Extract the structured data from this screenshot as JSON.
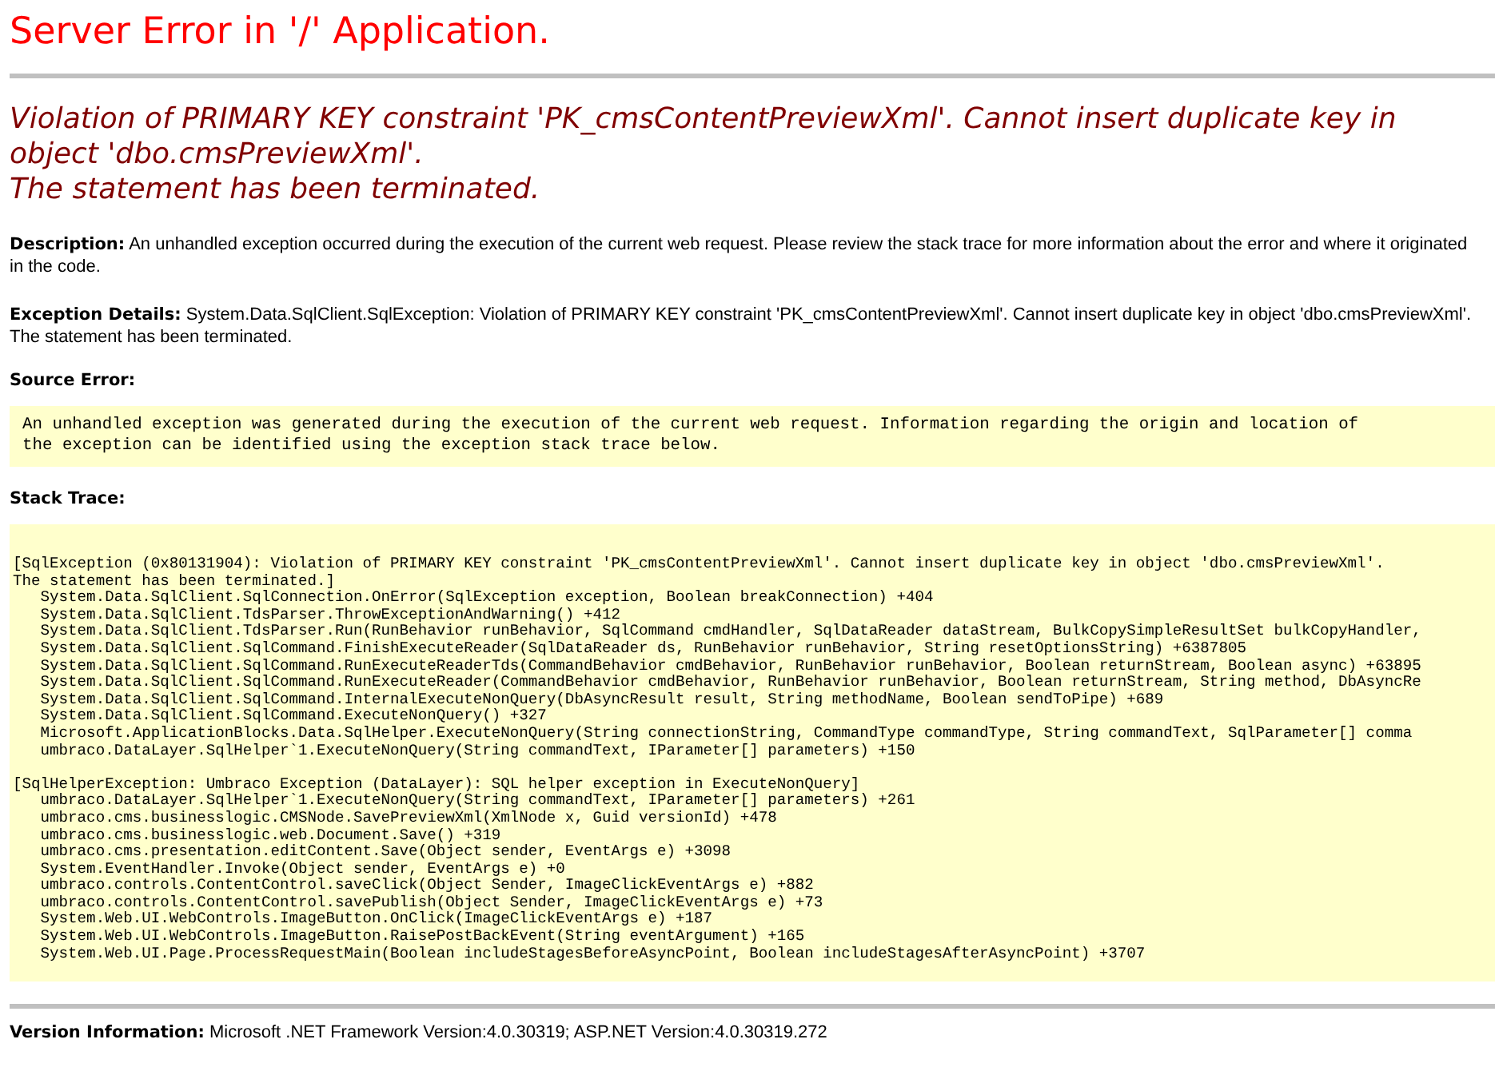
{
  "title": "Server Error in '/' Application.",
  "error_message": [
    "Violation of PRIMARY KEY constraint 'PK_cmsContentPreviewXml'. Cannot insert duplicate key in object 'dbo.cmsPreviewXml'.",
    "The statement has been terminated."
  ],
  "description": "**Description:** An unhandled exception occurred during the execution of the current web request. Please review the stack trace for more information about the error and where it originated in the code.",
  "exception_details": [
    "**Exception Details:** System.Data.SqlClient.SqlException: Violation of PRIMARY KEY constraint 'PK_cmsContentPreviewXml'. Cannot insert duplicate key in object 'dbo.cmsPreviewXml'.",
    "The statement has been terminated."
  ],
  "source_error": {
    "label": "Source Error:",
    "lines": [
      "An unhandled exception was generated during the execution of the current web request. Information regarding the origin and location of",
      "the exception can be identified using the exception stack trace below."
    ]
  },
  "stack_trace": {
    "label": "Stack Trace:",
    "blocks": [
      [
        "[SqlException (0x80131904): Violation of PRIMARY KEY constraint 'PK_cmsContentPreviewXml'. Cannot insert duplicate key in object 'dbo.cmsPreviewXml'.",
        "The statement has been terminated.]",
        "   System.Data.SqlClient.SqlConnection.OnError(SqlException exception, Boolean breakConnection) +404",
        "   System.Data.SqlClient.TdsParser.ThrowExceptionAndWarning() +412",
        "   System.Data.SqlClient.TdsParser.Run(RunBehavior runBehavior, SqlCommand cmdHandler, SqlDataReader dataStream, BulkCopySimpleResultSet bulkCopyHandler,",
        "   System.Data.SqlClient.SqlCommand.FinishExecuteReader(SqlDataReader ds, RunBehavior runBehavior, String resetOptionsString) +6387805",
        "   System.Data.SqlClient.SqlCommand.RunExecuteReaderTds(CommandBehavior cmdBehavior, RunBehavior runBehavior, Boolean returnStream, Boolean async) +63895",
        "   System.Data.SqlClient.SqlCommand.RunExecuteReader(CommandBehavior cmdBehavior, RunBehavior runBehavior, Boolean returnStream, String method, DbAsyncRe",
        "   System.Data.SqlClient.SqlCommand.InternalExecuteNonQuery(DbAsyncResult result, String methodName, Boolean sendToPipe) +689",
        "   System.Data.SqlClient.SqlCommand.ExecuteNonQuery() +327",
        "   Microsoft.ApplicationBlocks.Data.SqlHelper.ExecuteNonQuery(String connectionString, CommandType commandType, String commandText, SqlParameter[] comma",
        "   umbraco.DataLayer.SqlHelper`1.ExecuteNonQuery(String commandText, IParameter[] parameters) +150"
      ],
      [
        "[SqlHelperException: Umbraco Exception (DataLayer): SQL helper exception in ExecuteNonQuery]",
        "   umbraco.DataLayer.SqlHelper`1.ExecuteNonQuery(String commandText, IParameter[] parameters) +261",
        "   umbraco.cms.businesslogic.CMSNode.SavePreviewXml(XmlNode x, Guid versionId) +478",
        "   umbraco.cms.businesslogic.web.Document.Save() +319",
        "   umbraco.cms.presentation.editContent.Save(Object sender, EventArgs e) +3098",
        "   System.EventHandler.Invoke(Object sender, EventArgs e) +0",
        "   umbraco.controls.ContentControl.saveClick(Object Sender, ImageClickEventArgs e) +882",
        "   umbraco.controls.ContentControl.savePublish(Object Sender, ImageClickEventArgs e) +73",
        "   System.Web.UI.WebControls.ImageButton.OnClick(ImageClickEventArgs e) +187",
        "   System.Web.UI.WebControls.ImageButton.RaisePostBackEvent(String eventArgument) +165",
        "   System.Web.UI.Page.ProcessRequestMain(Boolean includeStagesBeforeAsyncPoint, Boolean includeStagesAfterAsyncPoint) +3707"
      ]
    ]
  },
  "version_info": "**Version Information:** Microsoft .NET Framework Version:4.0.30319; ASP.NET Version:4.0.30319.272"
}
